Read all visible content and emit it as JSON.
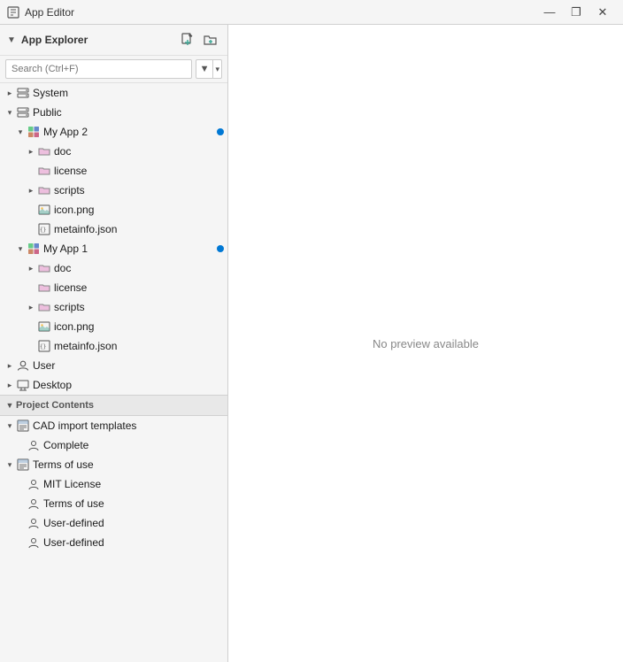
{
  "titleBar": {
    "icon": "app-editor-icon",
    "title": "App Editor",
    "minimize": "—",
    "maximize": "❐",
    "close": "✕"
  },
  "explorerHeader": {
    "collapseIcon": "▼",
    "title": "App Explorer",
    "newFileIcon": "+□",
    "newFolderIcon": "□+"
  },
  "search": {
    "placeholder": "Search (Ctrl+F)"
  },
  "tree": {
    "items": [
      {
        "id": "system",
        "level": 0,
        "expanded": false,
        "hasArrow": true,
        "icon": "server",
        "label": "System",
        "badge": false
      },
      {
        "id": "public",
        "level": 0,
        "expanded": true,
        "hasArrow": true,
        "icon": "server",
        "label": "Public",
        "badge": false
      },
      {
        "id": "myapp2",
        "level": 1,
        "expanded": true,
        "hasArrow": true,
        "icon": "app",
        "label": "My App 2",
        "badge": true
      },
      {
        "id": "myapp2-doc",
        "level": 2,
        "expanded": false,
        "hasArrow": true,
        "icon": "folder",
        "label": "doc",
        "badge": false
      },
      {
        "id": "myapp2-license",
        "level": 2,
        "expanded": false,
        "hasArrow": false,
        "icon": "folder",
        "label": "license",
        "badge": false
      },
      {
        "id": "myapp2-scripts",
        "level": 2,
        "expanded": false,
        "hasArrow": true,
        "icon": "folder",
        "label": "scripts",
        "badge": false
      },
      {
        "id": "myapp2-icon",
        "level": 2,
        "expanded": false,
        "hasArrow": false,
        "icon": "image",
        "label": "icon.png",
        "badge": false
      },
      {
        "id": "myapp2-meta",
        "level": 2,
        "expanded": false,
        "hasArrow": false,
        "icon": "json",
        "label": "metainfo.json",
        "badge": false
      },
      {
        "id": "myapp1",
        "level": 1,
        "expanded": true,
        "hasArrow": true,
        "icon": "app",
        "label": "My App 1",
        "badge": true
      },
      {
        "id": "myapp1-doc",
        "level": 2,
        "expanded": false,
        "hasArrow": true,
        "icon": "folder",
        "label": "doc",
        "badge": false
      },
      {
        "id": "myapp1-license",
        "level": 2,
        "expanded": false,
        "hasArrow": false,
        "icon": "folder",
        "label": "license",
        "badge": false
      },
      {
        "id": "myapp1-scripts",
        "level": 2,
        "expanded": false,
        "hasArrow": true,
        "icon": "folder",
        "label": "scripts",
        "badge": false
      },
      {
        "id": "myapp1-icon",
        "level": 2,
        "expanded": false,
        "hasArrow": false,
        "icon": "image",
        "label": "icon.png",
        "badge": false
      },
      {
        "id": "myapp1-meta",
        "level": 2,
        "expanded": false,
        "hasArrow": false,
        "icon": "json",
        "label": "metainfo.json",
        "badge": false
      },
      {
        "id": "user",
        "level": 0,
        "expanded": false,
        "hasArrow": true,
        "icon": "user",
        "label": "User",
        "badge": false
      },
      {
        "id": "desktop",
        "level": 0,
        "expanded": false,
        "hasArrow": true,
        "icon": "desktop",
        "label": "Desktop",
        "badge": false
      }
    ]
  },
  "projectContents": {
    "sectionLabel": "Project Contents",
    "items": [
      {
        "id": "cad",
        "level": 0,
        "expanded": true,
        "hasArrow": true,
        "icon": "template",
        "label": "CAD import templates",
        "badge": false
      },
      {
        "id": "cad-complete",
        "level": 1,
        "expanded": false,
        "hasArrow": false,
        "icon": "item",
        "label": "Complete",
        "badge": false
      },
      {
        "id": "terms",
        "level": 0,
        "expanded": true,
        "hasArrow": true,
        "icon": "template",
        "label": "Terms of use",
        "badge": false
      },
      {
        "id": "terms-mit",
        "level": 1,
        "expanded": false,
        "hasArrow": false,
        "icon": "item",
        "label": "MIT License",
        "badge": false
      },
      {
        "id": "terms-tou",
        "level": 1,
        "expanded": false,
        "hasArrow": false,
        "icon": "item",
        "label": "Terms of use",
        "badge": false
      },
      {
        "id": "terms-user1",
        "level": 1,
        "expanded": false,
        "hasArrow": false,
        "icon": "item",
        "label": "User-defined",
        "badge": false
      },
      {
        "id": "terms-user2",
        "level": 1,
        "expanded": false,
        "hasArrow": false,
        "icon": "item",
        "label": "User-defined",
        "badge": false
      }
    ]
  },
  "rightPanel": {
    "noPreviewText": "No preview available"
  }
}
